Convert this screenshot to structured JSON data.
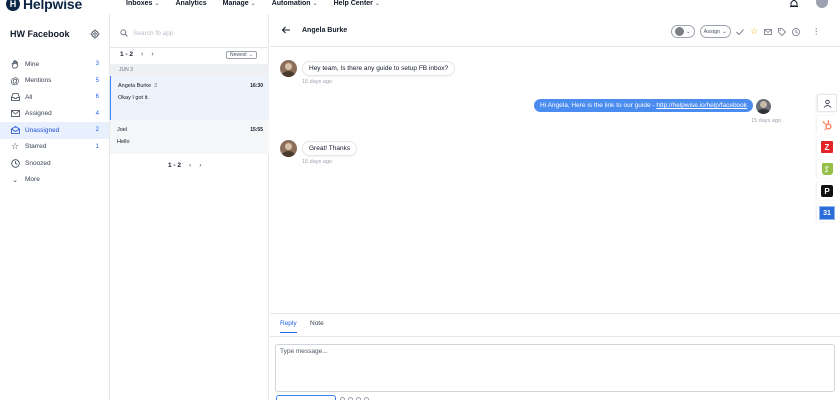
{
  "brand": {
    "name": "Helpwise"
  },
  "topnav": [
    {
      "label": "Inboxes",
      "has_menu": true
    },
    {
      "label": "Analytics",
      "has_menu": false
    },
    {
      "label": "Manage",
      "has_menu": true
    },
    {
      "label": "Automation",
      "has_menu": true
    },
    {
      "label": "Help Center",
      "has_menu": true
    }
  ],
  "sidebar": {
    "title": "HW Facebook",
    "items": [
      {
        "label": "Mine",
        "count": "3",
        "icon": "hand-icon"
      },
      {
        "label": "Mentions",
        "count": "5",
        "icon": "at-icon"
      },
      {
        "label": "All",
        "count": "6",
        "icon": "inbox-icon"
      },
      {
        "label": "Assigned",
        "count": "4",
        "icon": "mail-icon"
      },
      {
        "label": "Unassigned",
        "count": "2",
        "icon": "open-mail-icon",
        "active": true
      },
      {
        "label": "Starred",
        "count": "1",
        "icon": "star-icon"
      },
      {
        "label": "Snoozed",
        "count": "",
        "icon": "clock-icon"
      },
      {
        "label": "More",
        "count": "",
        "icon": "chevron-down-icon"
      }
    ]
  },
  "list": {
    "search_placeholder": "Search fb app",
    "pagination": "1 - 2",
    "sort_label": "Newest",
    "date_separator": "JUN 3",
    "conversations": [
      {
        "name": "Angela Burke",
        "count": "3",
        "time": "16:30",
        "preview": "Okay I got it.",
        "selected": true
      },
      {
        "name": "Joel",
        "count": "",
        "time": "15:55",
        "preview": "Hello",
        "selected": false
      }
    ],
    "pagination_bottom": "1 - 2"
  },
  "conversation": {
    "contact_name": "Angela Burke",
    "assign_label": "Assign",
    "messages": [
      {
        "direction": "in",
        "text": "Hey team, Is there any guide to setup FB inbox?",
        "time": "15 days ago"
      },
      {
        "direction": "out",
        "text": "Hi Angela, Here is the link to our guide - ",
        "link": "http://helpwise.io/help/facebook",
        "time": "15 days ago"
      },
      {
        "direction": "in",
        "text": "Great! Thanks",
        "time": "15 days ago"
      }
    ]
  },
  "apps": [
    {
      "name": "contact-app",
      "glyph": ""
    },
    {
      "name": "hubspot-app",
      "glyph": ""
    },
    {
      "name": "zoho-app",
      "glyph": "Z"
    },
    {
      "name": "shopify-app",
      "glyph": ""
    },
    {
      "name": "pipedrive-app",
      "glyph": "P"
    },
    {
      "name": "google-calendar-app",
      "glyph": "31"
    }
  ],
  "compose": {
    "tabs": [
      "Reply",
      "Note"
    ],
    "placeholder": "Type message..."
  },
  "colors": {
    "accent": "#4a8cf0",
    "brand_dark": "#0b2545",
    "active_bg": "#e8f0fe",
    "count_blue": "#2563eb"
  }
}
